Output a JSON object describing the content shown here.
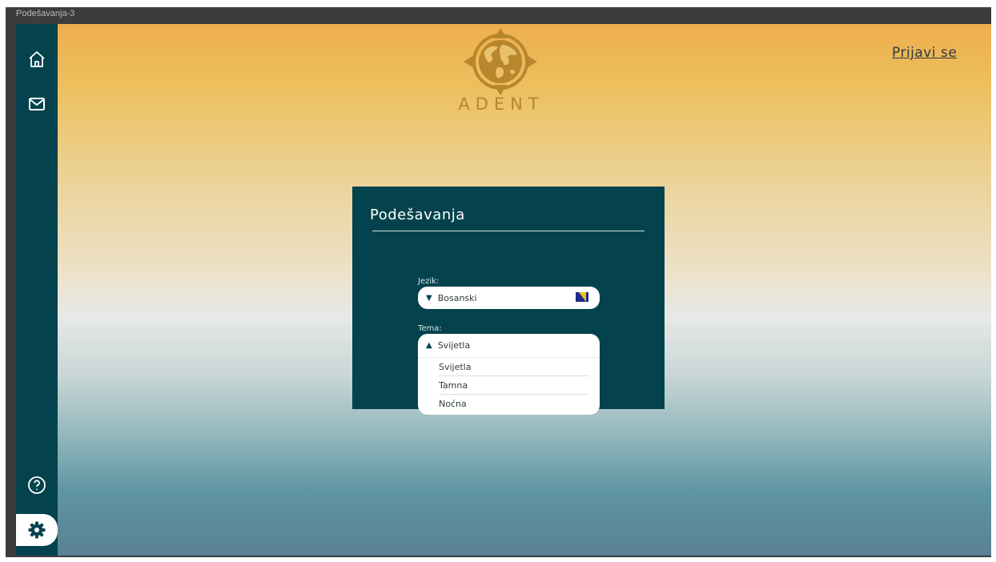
{
  "window": {
    "title": "Podešavanja-3"
  },
  "sidebar": {
    "items": [
      {
        "icon": "home-icon"
      },
      {
        "icon": "mail-icon"
      },
      {
        "icon": "help-icon"
      },
      {
        "icon": "gear-icon",
        "active": true
      }
    ]
  },
  "header": {
    "brand": "ADENT",
    "login_label": "Prijavi se"
  },
  "settings": {
    "title": "Podešavanja",
    "language": {
      "label": "Jezik:",
      "value": "Bosanski",
      "flag": "bosnia-flag-icon"
    },
    "theme": {
      "label": "Tema:",
      "value": "Svijetla",
      "options": [
        "Svijetla",
        "Tamna",
        "Noćna"
      ]
    }
  },
  "colors": {
    "panel": "#04434d",
    "sidebar": "#04434d",
    "brand": "#b8862d",
    "gradient_top": "#eeae4e",
    "gradient_bottom": "#5a8193"
  }
}
